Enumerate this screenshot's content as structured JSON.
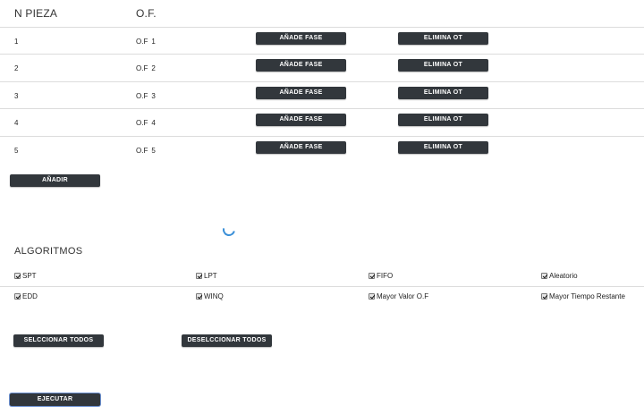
{
  "table": {
    "headers": [
      "N PIEZA",
      "O.F."
    ],
    "rows": [
      {
        "pieza": "1",
        "of_prefix": "O.F",
        "of_num": "1",
        "add_phase": "AÑADE FASE",
        "remove": "ELIMINA OT"
      },
      {
        "pieza": "2",
        "of_prefix": "O.F",
        "of_num": "2",
        "add_phase": "AÑADE FASE",
        "remove": "ELIMINA OT"
      },
      {
        "pieza": "3",
        "of_prefix": "O.F",
        "of_num": "3",
        "add_phase": "AÑADE FASE",
        "remove": "ELIMINA OT"
      },
      {
        "pieza": "4",
        "of_prefix": "O.F",
        "of_num": "4",
        "add_phase": "AÑADE FASE",
        "remove": "ELIMINA OT"
      },
      {
        "pieza": "5",
        "of_prefix": "O.F",
        "of_num": "5",
        "add_phase": "AÑADE FASE",
        "remove": "ELIMINA OT"
      }
    ]
  },
  "add_button": "AÑADIR",
  "algorithms": {
    "title": "ALGORITMOS",
    "items": [
      {
        "label": "SPT",
        "checked": true
      },
      {
        "label": "LPT",
        "checked": true
      },
      {
        "label": "FIFO",
        "checked": true
      },
      {
        "label": "Aleatorio",
        "checked": true
      },
      {
        "label": "EDD",
        "checked": true
      },
      {
        "label": "WINQ",
        "checked": true
      },
      {
        "label": "Mayor Valor O.F",
        "checked": true
      },
      {
        "label": "Mayor Tiempo Restante",
        "checked": true
      }
    ]
  },
  "select_all_button": "SELCCIONAR TODOS",
  "deselect_all_button": "DESELCCIONAR TODOS",
  "run_button": "EJECUTAR",
  "colors": {
    "button_bg": "#32373c",
    "spinner": "#3a8fd8"
  }
}
